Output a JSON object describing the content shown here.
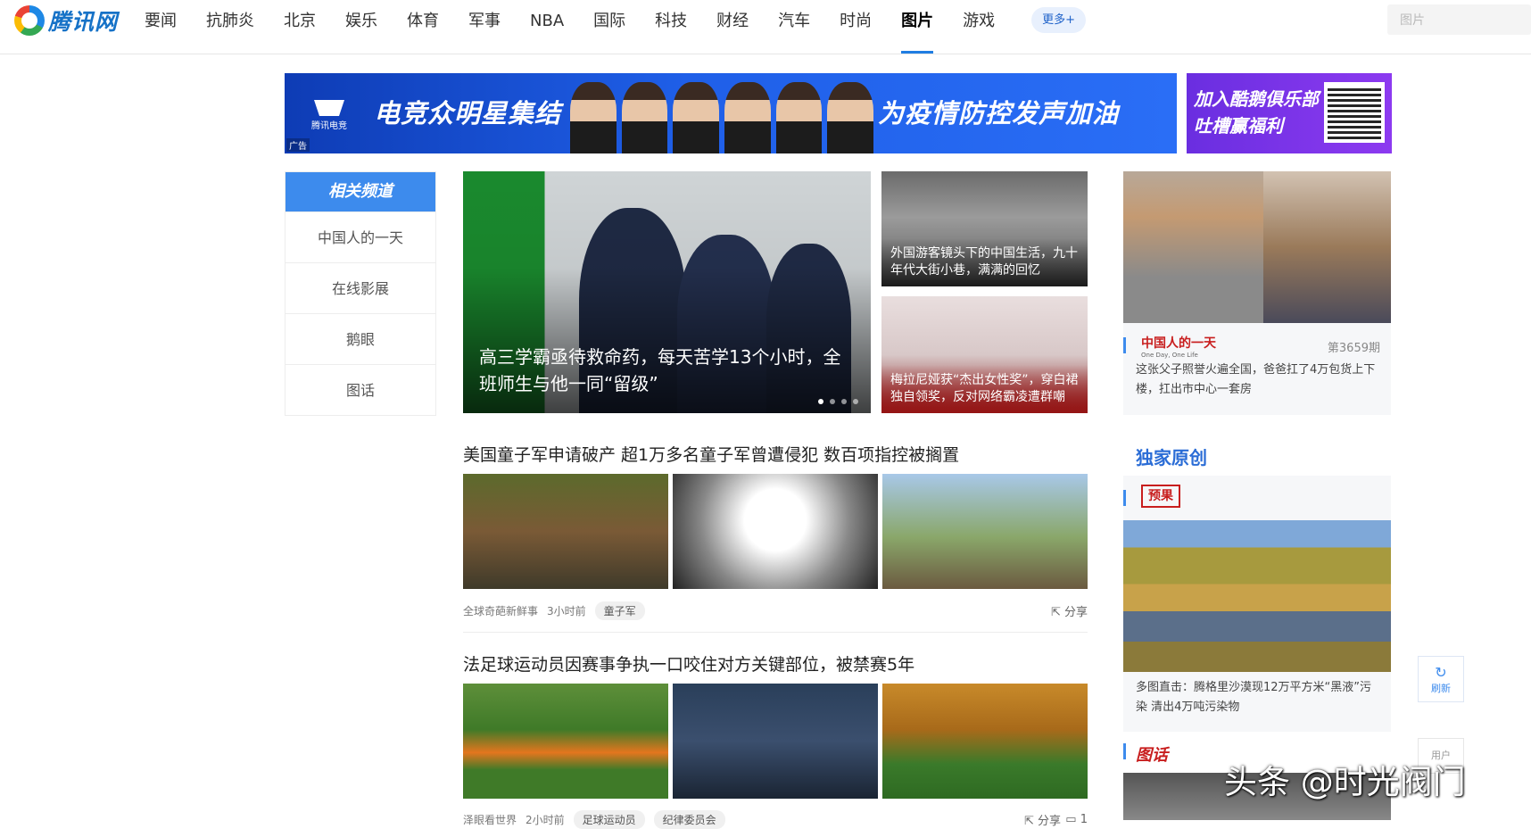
{
  "header": {
    "logo_text": "腾讯网",
    "nav": [
      "要闻",
      "抗肺炎",
      "北京",
      "娱乐",
      "体育",
      "军事",
      "NBA",
      "国际",
      "科技",
      "财经",
      "汽车",
      "时尚",
      "图片",
      "游戏"
    ],
    "active_index": 12,
    "more_label": "更多+",
    "search_placeholder": "图片"
  },
  "ad_main": {
    "logo_text": "腾讯电竞",
    "title_left": "电竞众明星集结",
    "title_right": "为疫情防控发声加油",
    "tag": "广告"
  },
  "ad_side": {
    "line1": "加入酷鹅俱乐部",
    "line2": "吐槽赢福利"
  },
  "sidebar": {
    "heading": "相关频道",
    "items": [
      "中国人的一天",
      "在线影展",
      "鹅眼",
      "图话"
    ]
  },
  "hero": {
    "caption": "高三学霸亟待救命药，每天苦学13个小时，全班师生与他一同“留级”"
  },
  "tiles": [
    {
      "caption": "外国游客镜头下的中国生活，九十年代大街小巷，满满的回忆"
    },
    {
      "caption": "梅拉尼娅获“杰出女性奖”，穿白裙独自领奖，反对网络霸凌遭群嘲"
    }
  ],
  "articles": [
    {
      "title": "美国童子军申请破产 超1万多名童子军曾遭侵犯 数百项指控被搁置",
      "source": "全球奇葩新鲜事",
      "time": "3小时前",
      "tags": [
        "童子军"
      ],
      "share": "分享"
    },
    {
      "title": "法足球运动员因赛事争执一口咬住对方关键部位，被禁赛5年",
      "source": "泽眼看世界",
      "time": "2小时前",
      "tags": [
        "足球运动员",
        "纪律委员会"
      ],
      "share": "分享",
      "comments": "1"
    }
  ],
  "feature": {
    "column_logo": "中国人的一天",
    "column_logo_sub": "One Day, One Life",
    "issue": "第3659期",
    "text": "这张父子照誉火遍全国，爸爸扛了4万包货上下楼，扛出市中心一套房"
  },
  "original": {
    "section_title": "独家原创",
    "logo": "预果",
    "text": "多图直击：腾格里沙漠现12万平方米“黑液”污染 清出4万吨污染物"
  },
  "float": {
    "refresh_label": "刷新",
    "user_label": "用户"
  },
  "next_logo": "图话",
  "watermark": "头条 @时光阀门"
}
